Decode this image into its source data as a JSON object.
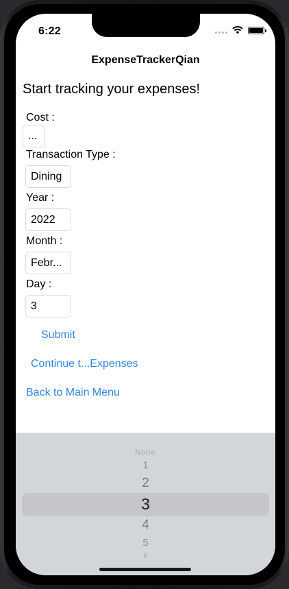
{
  "status_bar": {
    "time": "6:22"
  },
  "nav": {
    "title": "ExpenseTrackerQian"
  },
  "main": {
    "heading": "Start tracking your expenses!",
    "cost_label": "Cost :",
    "cost_value": "...",
    "transaction_label": "Transaction Type :",
    "transaction_value": "Dining",
    "year_label": "Year :",
    "year_value": "2022",
    "month_label": "Month :",
    "month_value": "Febr...",
    "day_label": "Day :",
    "day_value": "3",
    "submit_label": "Submit",
    "continue_label": "Continue t...Expenses",
    "back_label": "Back to Main Menu"
  },
  "picker": {
    "items": [
      "None",
      "1",
      "2",
      "3",
      "4",
      "5",
      "6"
    ],
    "selected": "3"
  },
  "colors": {
    "link": "#2f86e6",
    "picker_bg": "#d2d5da"
  }
}
